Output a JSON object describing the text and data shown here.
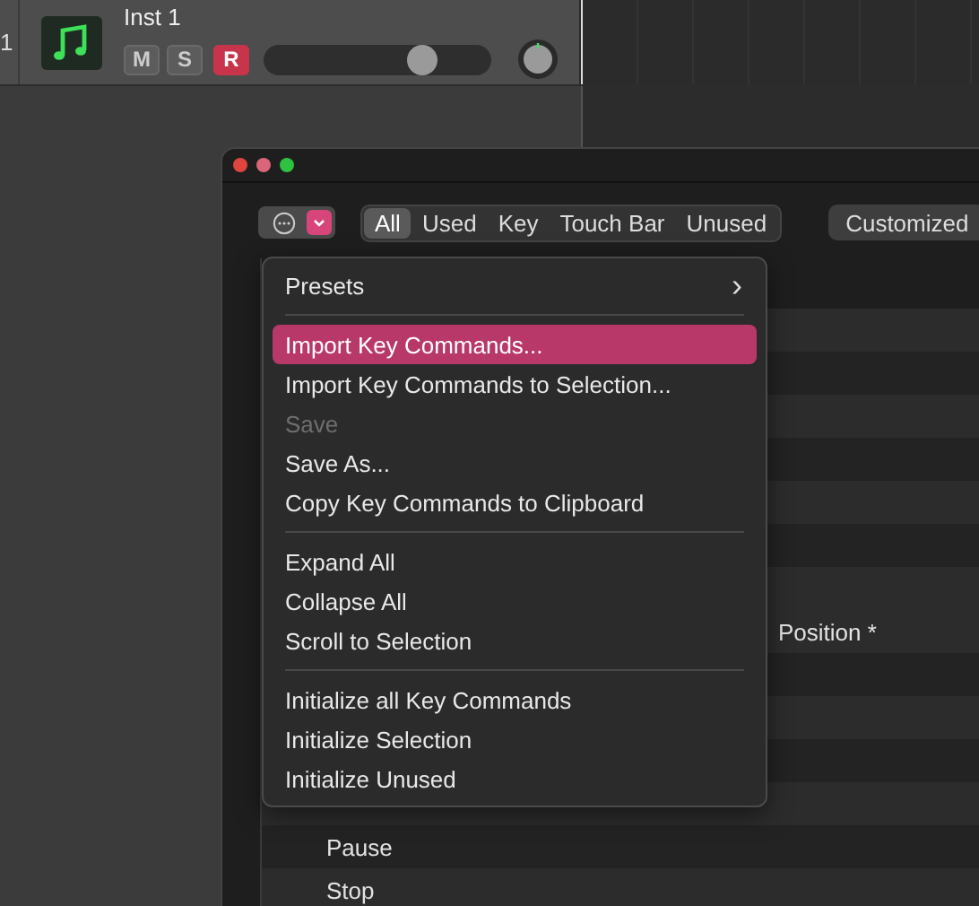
{
  "track": {
    "number": "1",
    "name": "Inst 1",
    "buttons": [
      {
        "label": "M",
        "on": false
      },
      {
        "label": "S",
        "on": false
      },
      {
        "label": "R",
        "on": true
      }
    ],
    "volume": {
      "level": 0.7
    }
  },
  "toolbar": {
    "filters": [
      {
        "label": "All",
        "selected": true
      },
      {
        "label": "Used",
        "selected": false
      },
      {
        "label": "Key",
        "selected": false
      },
      {
        "label": "Touch Bar",
        "selected": false
      },
      {
        "label": "Unused",
        "selected": false
      }
    ],
    "customized": "Customized"
  },
  "menu": [
    {
      "kind": "submenu",
      "label": "Presets",
      "arrow": "›",
      "selected": false,
      "disabled": false
    },
    {
      "kind": "separator"
    },
    {
      "kind": "item",
      "label": "Import Key Commands...",
      "selected": true,
      "disabled": false
    },
    {
      "kind": "item",
      "label": "Import Key Commands to Selection...",
      "selected": false,
      "disabled": false
    },
    {
      "kind": "item",
      "label": "Save",
      "selected": false,
      "disabled": true
    },
    {
      "kind": "item",
      "label": "Save As...",
      "selected": false,
      "disabled": false
    },
    {
      "kind": "item",
      "label": "Copy Key Commands to Clipboard",
      "selected": false,
      "disabled": false
    },
    {
      "kind": "separator"
    },
    {
      "kind": "item",
      "label": "Expand All",
      "selected": false,
      "disabled": false
    },
    {
      "kind": "item",
      "label": "Collapse All",
      "selected": false,
      "disabled": false
    },
    {
      "kind": "item",
      "label": "Scroll to Selection",
      "selected": false,
      "disabled": false
    },
    {
      "kind": "separator"
    },
    {
      "kind": "item",
      "label": "Initialize all Key Commands",
      "selected": false,
      "disabled": false
    },
    {
      "kind": "item",
      "label": "Initialize Selection",
      "selected": false,
      "disabled": false
    },
    {
      "kind": "item",
      "label": "Initialize Unused",
      "selected": false,
      "disabled": false
    }
  ],
  "list": {
    "upper_rows": [
      {
        "text": "Position *"
      }
    ],
    "lower_rows": [
      {
        "text": "Pause"
      },
      {
        "text": "Stop"
      }
    ]
  }
}
